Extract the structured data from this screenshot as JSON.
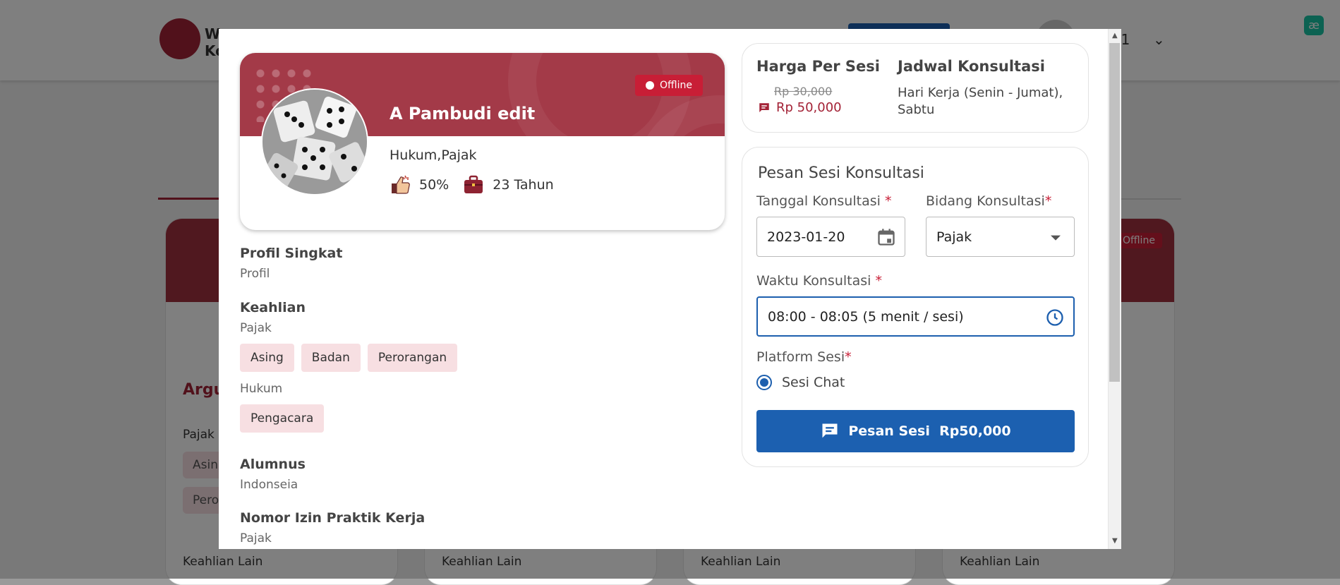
{
  "background": {
    "logo_text": "W\nKo",
    "user_name": "T 1",
    "card_title": "Argu",
    "card_status": "Offline",
    "card_field": "Pajak",
    "card_chip_1": "Asin",
    "card_chip_2": "Pero",
    "other_skills_label": "Keahlian Lain"
  },
  "profile": {
    "status": "Offline",
    "name": "A Pambudi edit",
    "specialty": "Hukum,Pajak",
    "rating": "50%",
    "experience": "23 Tahun"
  },
  "sections": {
    "short_profile_title": "Profil Singkat",
    "short_profile_value": "Profil",
    "expertise_title": "Keahlian",
    "expertise_groups": [
      {
        "name": "Pajak",
        "chips": [
          "Asing",
          "Badan",
          "Perorangan"
        ]
      },
      {
        "name": "Hukum",
        "chips": [
          "Pengacara"
        ]
      }
    ],
    "alumnus_title": "Alumnus",
    "alumnus_value": "Indonseia",
    "license_title": "Nomor Izin Praktik Kerja",
    "license_value": "Pajak"
  },
  "pricing": {
    "price_title": "Harga Per Sesi",
    "old_price": "Rp 30,000",
    "new_price": "Rp 50,000",
    "schedule_title": "Jadwal Konsultasi",
    "schedule_value": "Hari Kerja (Senin - Jumat), Sabtu"
  },
  "booking": {
    "title": "Pesan Sesi Konsultasi",
    "date_label": "Tanggal Konsultasi",
    "date_value": "2023-01-20",
    "field_label": "Bidang Konsultasi",
    "field_value": "Pajak",
    "time_label": "Waktu Konsultasi",
    "time_value": "08:00 - 08:05 (5 menit / sesi)",
    "platform_label": "Platform Sesi",
    "platform_option": "Sesi Chat",
    "button_label": "Pesan Sesi  Rp50,000",
    "required_mark": "*"
  },
  "colors": {
    "brand": "#a32236",
    "primary": "#1c60b0",
    "chip_bg": "#f7dfe2"
  },
  "icons": {
    "rating": "thumbs-up-icon",
    "experience": "briefcase-icon",
    "price": "chat-icon",
    "date": "calendar-icon",
    "time": "clock-icon",
    "dropdown": "caret-down-icon"
  }
}
